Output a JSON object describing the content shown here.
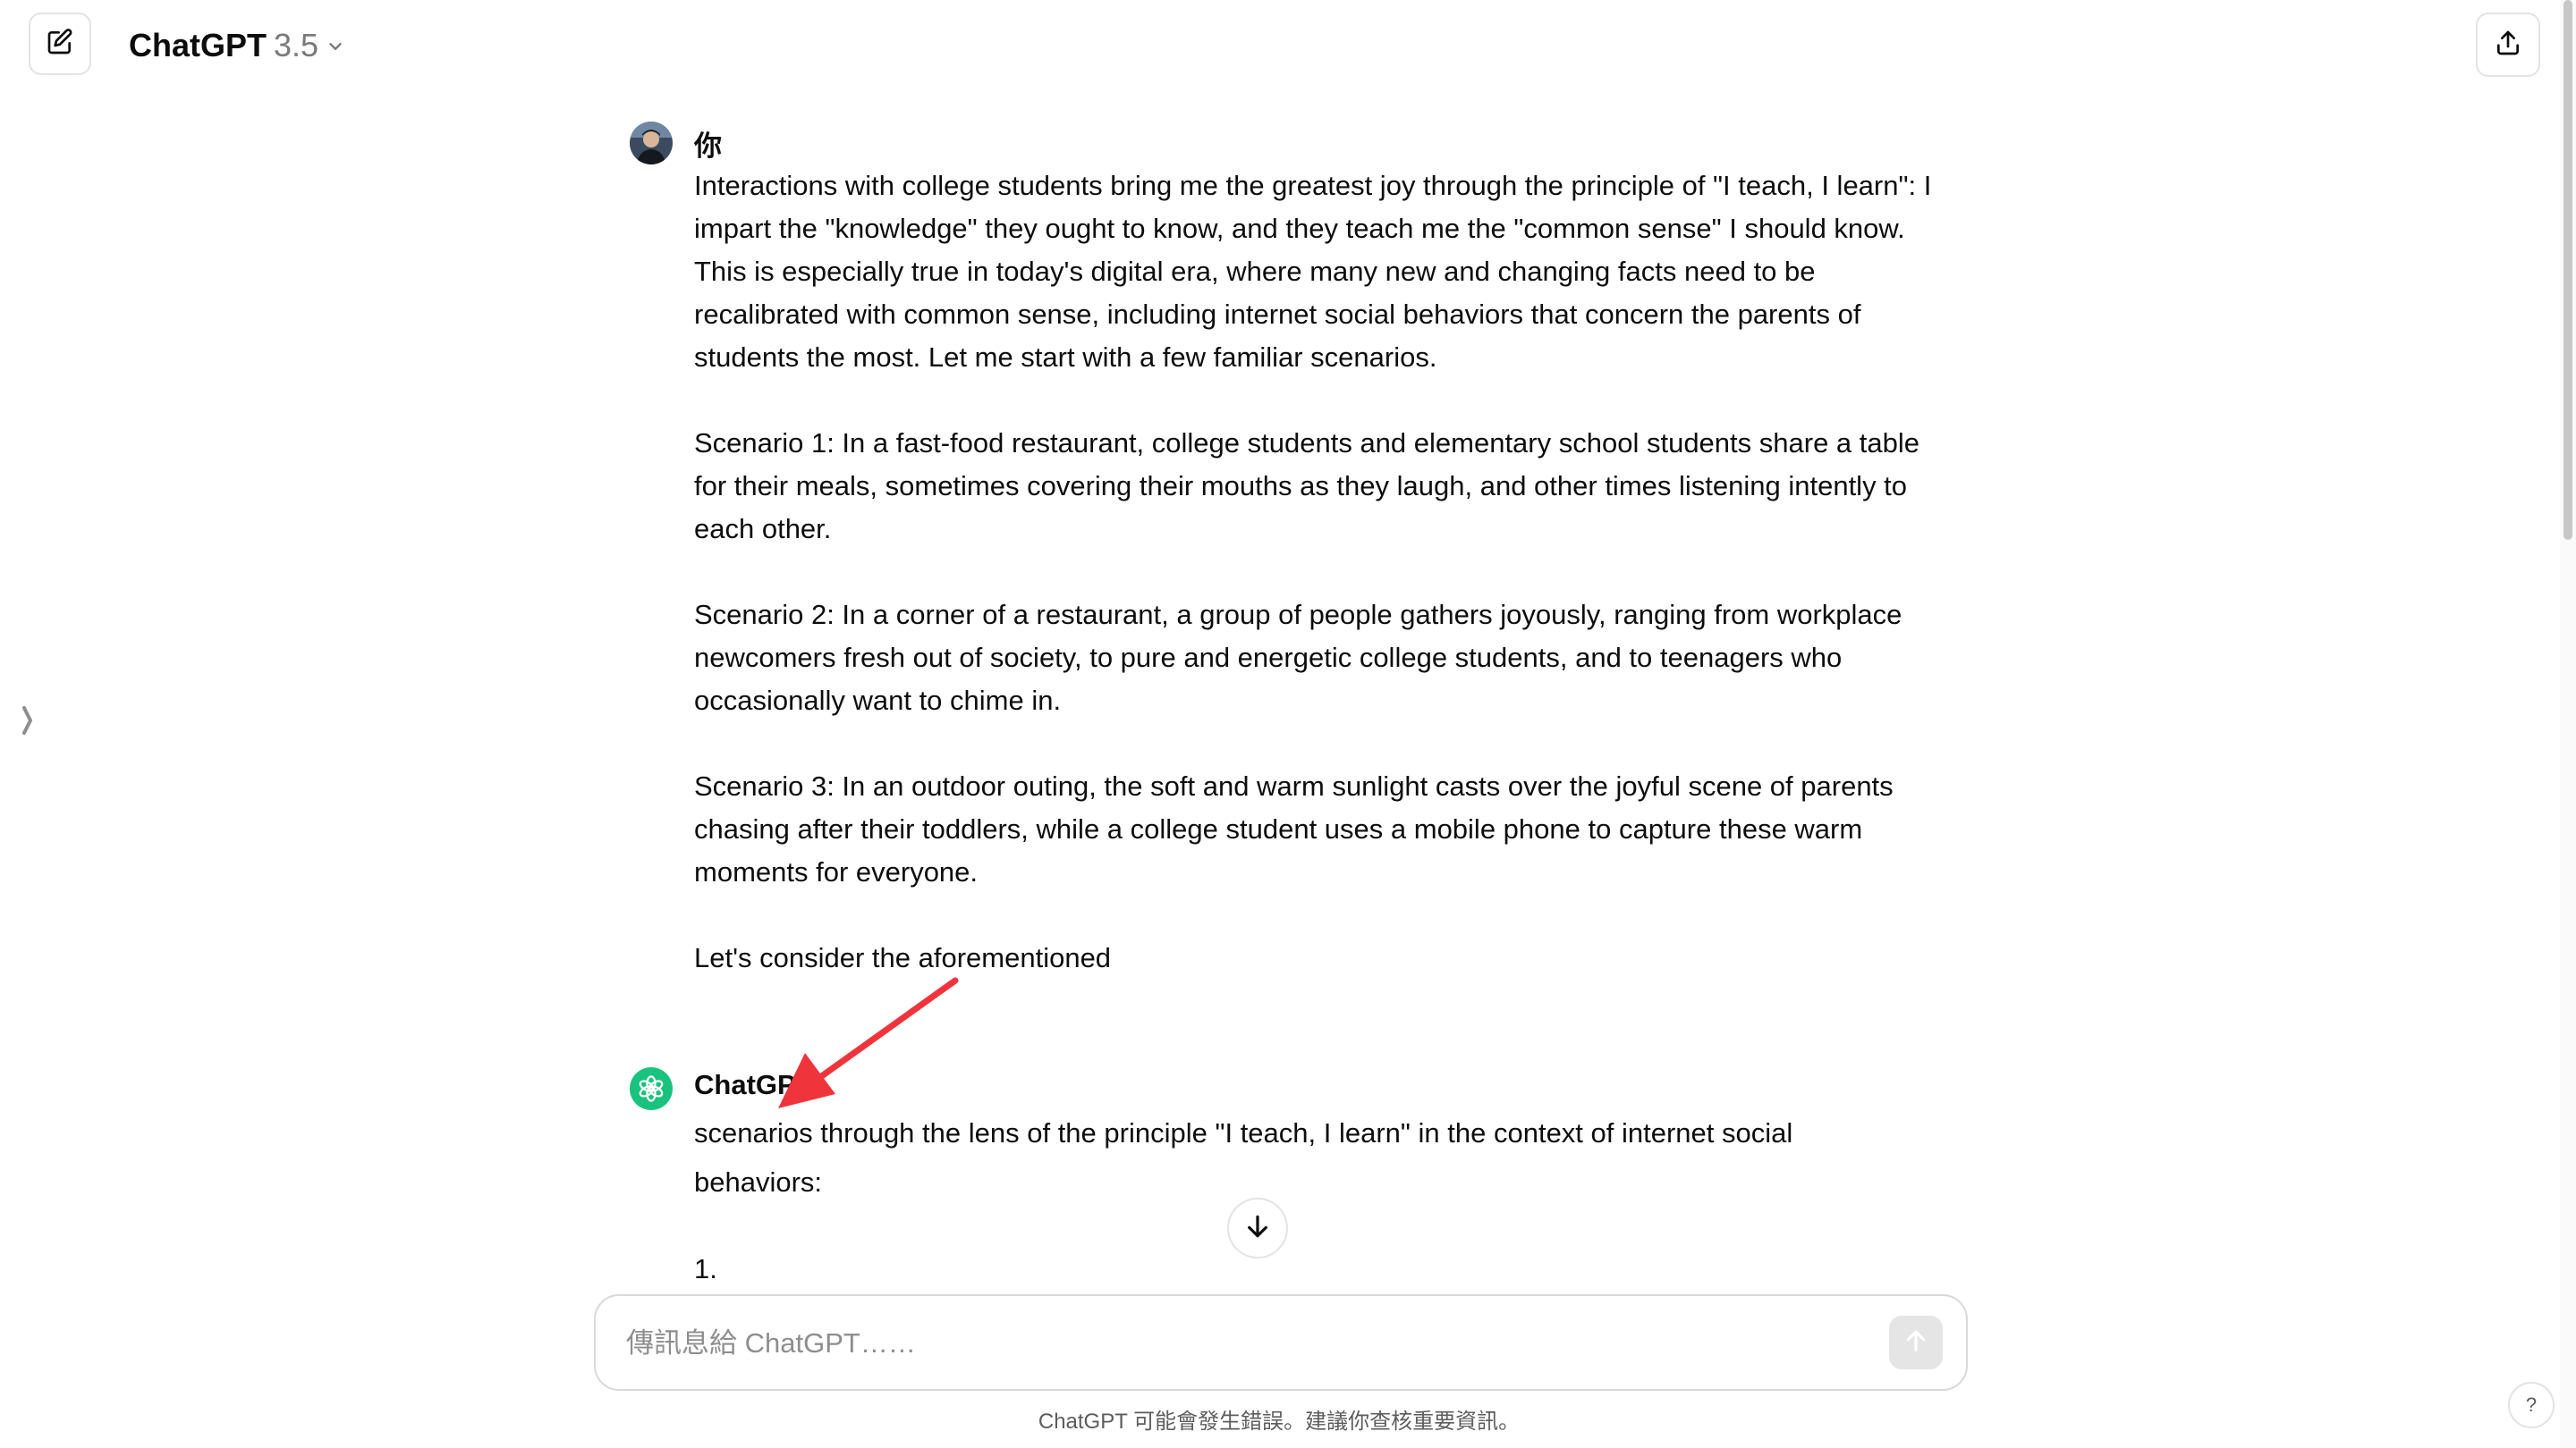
{
  "header": {
    "model_name": "ChatGPT",
    "model_version": "3.5",
    "icons": {
      "new_chat": "edit-icon",
      "model_menu": "chevron-down-icon",
      "share": "share-icon"
    }
  },
  "conversation": {
    "user": {
      "name": "你",
      "paragraphs": [
        "Interactions with college students bring me the greatest joy through the principle of \"I teach, I learn\": I impart the \"knowledge\" they ought to know, and they teach me the \"common sense\" I should know. This is especially true in today's digital era, where many new and changing facts need to be recalibrated with common sense, including internet social behaviors that concern the parents of students the most. Let me start with a few familiar scenarios.",
        "Scenario 1: In a fast-food restaurant, college students and elementary school students share a table for their meals, sometimes covering their mouths as they laugh, and other times listening intently to each other.",
        "Scenario 2: In a corner of a restaurant, a group of people gathers joyously, ranging from workplace newcomers fresh out of society, to pure and energetic college students, and to teenagers who occasionally want to chime in.",
        "Scenario 3: In an outdoor outing, the soft and warm sunlight casts over the joyful scene of parents chasing after their toddlers, while a college student uses a mobile phone to capture these warm moments for everyone.",
        "Let's consider the aforementioned"
      ]
    },
    "assistant": {
      "name": "ChatGPT",
      "text": "scenarios through the lens of the principle \"I teach, I learn\" in the context of internet social behaviors:",
      "list_start": "1."
    }
  },
  "composer": {
    "placeholder": "傳訊息給 ChatGPT……"
  },
  "footer": {
    "disclaimer": "ChatGPT 可能會發生錯誤。建議你查核重要資訊。",
    "help_label": "?"
  },
  "colors": {
    "assistant_avatar": "#19c37d",
    "annotation_arrow": "#f0343c"
  }
}
